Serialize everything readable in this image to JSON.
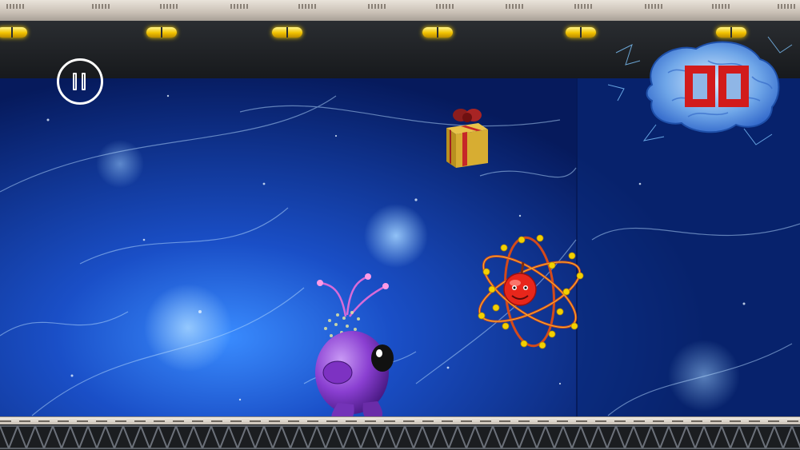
{
  "game": {
    "score_digits": [
      "0",
      "0"
    ],
    "score": "00"
  },
  "hud": {
    "pause_icon": "pause-icon",
    "score_icon": "brain-icon"
  },
  "colors": {
    "score_red": "#d21b1b",
    "rail_light": "#f2c200",
    "background_blue": "#0d2e8a",
    "alien_purple": "#8a3fd1",
    "atom_red": "#e8261b",
    "atom_gold": "#f3d100"
  },
  "objects": {
    "gift": "gift-box-icon",
    "atom": "atom-icon",
    "player": "purple-alien-icon"
  }
}
